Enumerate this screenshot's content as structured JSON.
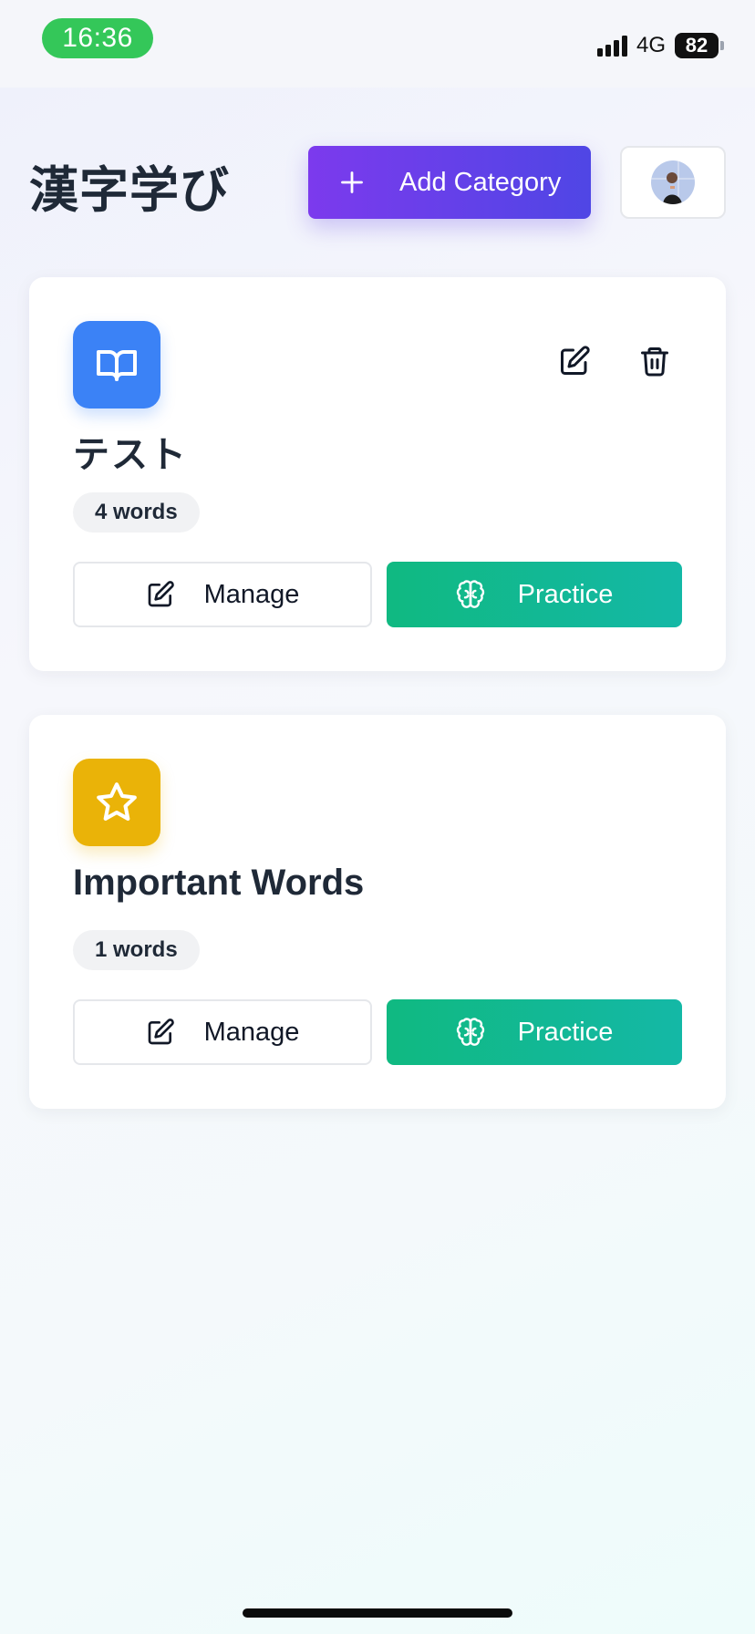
{
  "status_bar": {
    "time": "16:36",
    "network": "4G",
    "battery": "82",
    "time_pill_color": "#34c759"
  },
  "header": {
    "title": "漢字学び",
    "add_button_label": "Add Category",
    "avatar_icon": "user-avatar"
  },
  "categories": [
    {
      "title": "テスト",
      "word_count": "4 words",
      "icon": "book-open-icon",
      "icon_color": "#3b82f6",
      "manage_label": "Manage",
      "practice_label": "Practice",
      "has_edit_delete": true
    },
    {
      "title": "Important Words",
      "word_count": "1 words",
      "icon": "star-icon",
      "icon_color": "#eab308",
      "manage_label": "Manage",
      "practice_label": "Practice",
      "has_edit_delete": false
    }
  ],
  "colors": {
    "add_button_gradient": [
      "#7c3aed",
      "#4f46e5"
    ],
    "practice_gradient": [
      "#10b981",
      "#14b8a6"
    ]
  }
}
